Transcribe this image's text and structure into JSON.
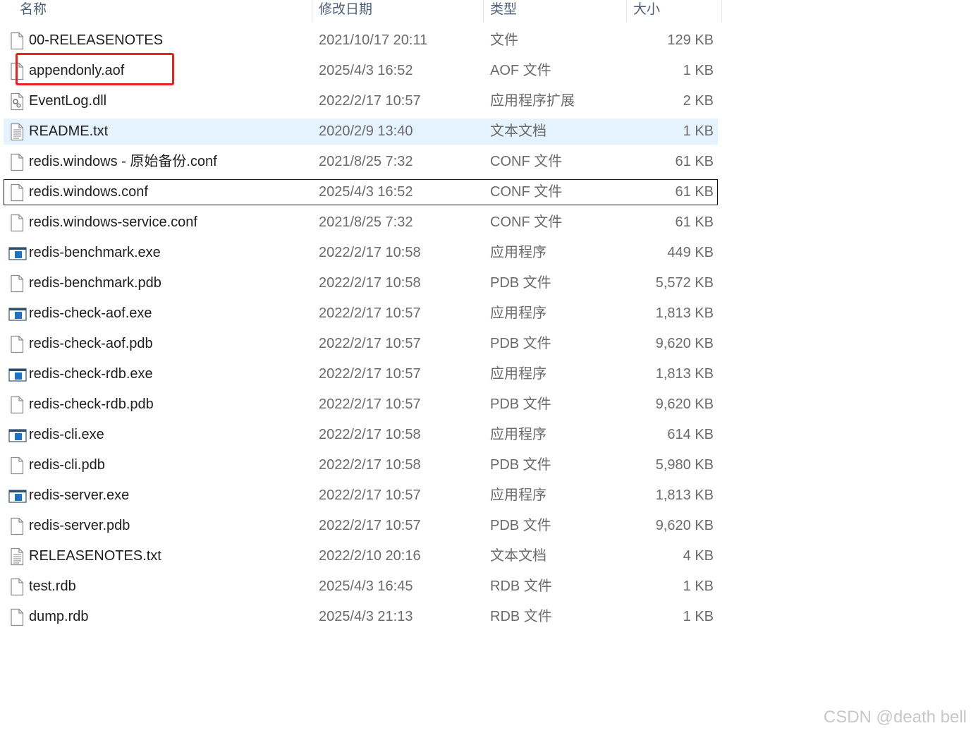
{
  "columns": {
    "name": "名称",
    "date": "修改日期",
    "type": "类型",
    "size": "大小"
  },
  "files": [
    {
      "name": "00-RELEASENOTES",
      "date": "2021/10/17 20:11",
      "type": "文件",
      "size": "129 KB",
      "icon": "blank-file-icon"
    },
    {
      "name": "appendonly.aof",
      "date": "2025/4/3 16:52",
      "type": "AOF 文件",
      "size": "1 KB",
      "icon": "blank-file-icon"
    },
    {
      "name": "EventLog.dll",
      "date": "2022/2/17 10:57",
      "type": "应用程序扩展",
      "size": "2 KB",
      "icon": "dll-file-icon"
    },
    {
      "name": "README.txt",
      "date": "2020/2/9 13:40",
      "type": "文本文档",
      "size": "1 KB",
      "icon": "text-file-icon"
    },
    {
      "name": "redis.windows - 原始备份.conf",
      "date": "2021/8/25 7:32",
      "type": "CONF 文件",
      "size": "61 KB",
      "icon": "blank-file-icon"
    },
    {
      "name": "redis.windows.conf",
      "date": "2025/4/3 16:52",
      "type": "CONF 文件",
      "size": "61 KB",
      "icon": "blank-file-icon"
    },
    {
      "name": "redis.windows-service.conf",
      "date": "2021/8/25 7:32",
      "type": "CONF 文件",
      "size": "61 KB",
      "icon": "blank-file-icon"
    },
    {
      "name": "redis-benchmark.exe",
      "date": "2022/2/17 10:58",
      "type": "应用程序",
      "size": "449 KB",
      "icon": "exe-file-icon"
    },
    {
      "name": "redis-benchmark.pdb",
      "date": "2022/2/17 10:58",
      "type": "PDB 文件",
      "size": "5,572 KB",
      "icon": "blank-file-icon"
    },
    {
      "name": "redis-check-aof.exe",
      "date": "2022/2/17 10:57",
      "type": "应用程序",
      "size": "1,813 KB",
      "icon": "exe-file-icon"
    },
    {
      "name": "redis-check-aof.pdb",
      "date": "2022/2/17 10:57",
      "type": "PDB 文件",
      "size": "9,620 KB",
      "icon": "blank-file-icon"
    },
    {
      "name": "redis-check-rdb.exe",
      "date": "2022/2/17 10:57",
      "type": "应用程序",
      "size": "1,813 KB",
      "icon": "exe-file-icon"
    },
    {
      "name": "redis-check-rdb.pdb",
      "date": "2022/2/17 10:57",
      "type": "PDB 文件",
      "size": "9,620 KB",
      "icon": "blank-file-icon"
    },
    {
      "name": "redis-cli.exe",
      "date": "2022/2/17 10:58",
      "type": "应用程序",
      "size": "614 KB",
      "icon": "exe-file-icon"
    },
    {
      "name": "redis-cli.pdb",
      "date": "2022/2/17 10:58",
      "type": "PDB 文件",
      "size": "5,980 KB",
      "icon": "blank-file-icon"
    },
    {
      "name": "redis-server.exe",
      "date": "2022/2/17 10:57",
      "type": "应用程序",
      "size": "1,813 KB",
      "icon": "exe-file-icon"
    },
    {
      "name": "redis-server.pdb",
      "date": "2022/2/17 10:57",
      "type": "PDB 文件",
      "size": "9,620 KB",
      "icon": "blank-file-icon"
    },
    {
      "name": "RELEASENOTES.txt",
      "date": "2022/2/10 20:16",
      "type": "文本文档",
      "size": "4 KB",
      "icon": "text-file-icon"
    },
    {
      "name": "test.rdb",
      "date": "2025/4/3 16:45",
      "type": "RDB 文件",
      "size": "1 KB",
      "icon": "blank-file-icon"
    },
    {
      "name": "dump.rdb",
      "date": "2025/4/3 21:13",
      "type": "RDB 文件",
      "size": "1 KB",
      "icon": "blank-file-icon"
    }
  ],
  "hovered_row": 3,
  "focused_row": 5,
  "annotation": {
    "color": "#e8231e",
    "target": "appendonly.aof"
  },
  "colors": {
    "hover": "#e5f3ff",
    "header_text": "#4c607a",
    "exe_icon": "#1a73c7"
  },
  "watermark": "CSDN @death bell"
}
